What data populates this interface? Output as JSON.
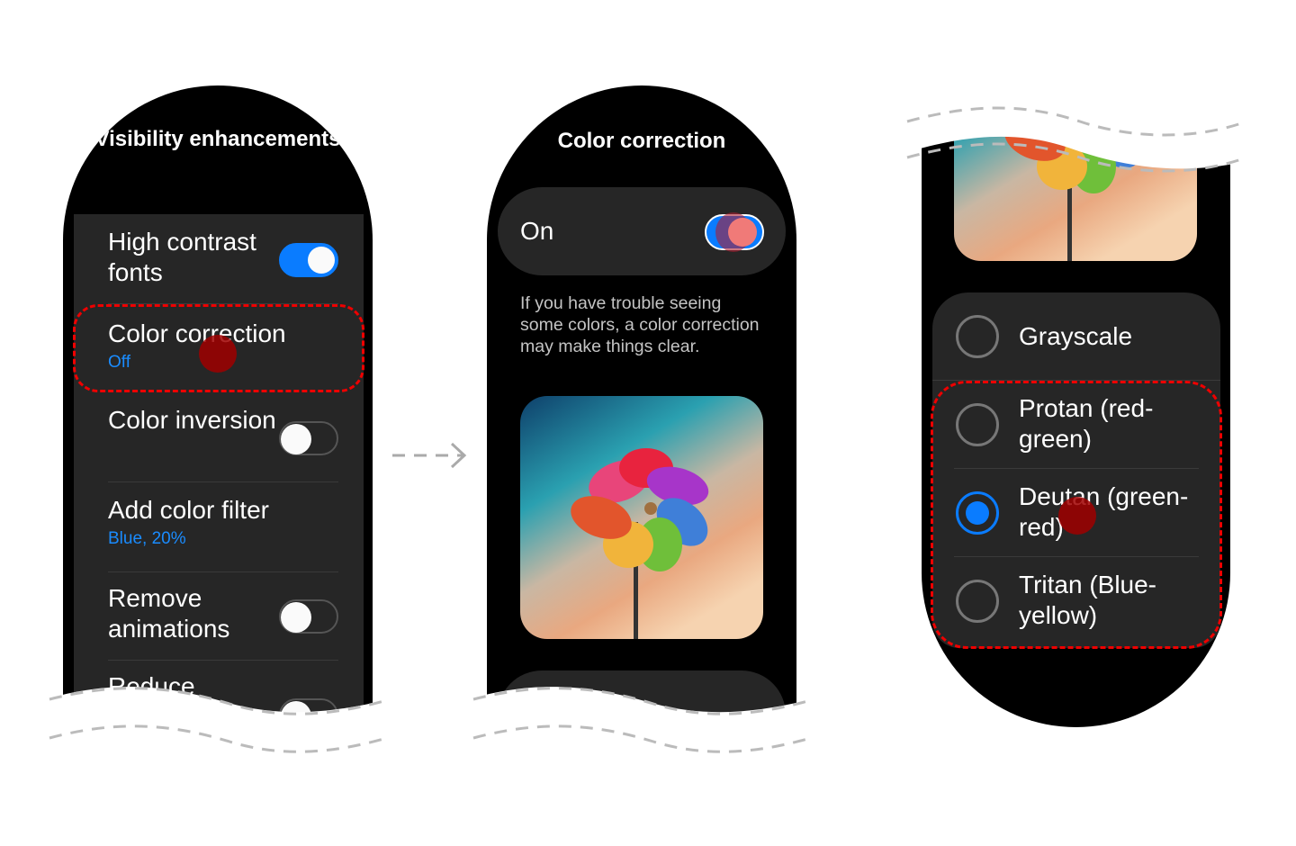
{
  "screen1": {
    "title": "Visibility enhancements",
    "items": [
      {
        "label": "High contrast fonts",
        "toggle": "on"
      },
      {
        "label": "Color correction",
        "value": "Off"
      },
      {
        "label": "Color inversion",
        "toggle": "off"
      },
      {
        "label": "Add color filter",
        "value": "Blue, 20%"
      },
      {
        "label": "Remove animations",
        "toggle": "off"
      },
      {
        "label": "Reduce",
        "toggle": "off"
      }
    ]
  },
  "screen2": {
    "title": "Color correction",
    "switch_label": "On",
    "switch_state": "on",
    "description": "If you have trouble seeing some colors, a color correction may make things clear."
  },
  "screen3": {
    "options": [
      {
        "label": "Grayscale",
        "selected": false
      },
      {
        "label": "Protan (red-green)",
        "selected": false
      },
      {
        "label": "Deutan (green-red)",
        "selected": true
      },
      {
        "label": "Tritan (Blue-yellow)",
        "selected": false
      }
    ]
  },
  "colors": {
    "accent": "#0a7cff",
    "highlight": "#e00000",
    "panel": "#262626"
  }
}
